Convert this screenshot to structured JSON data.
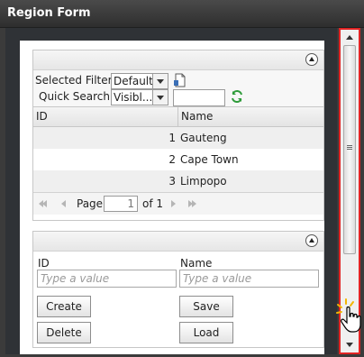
{
  "window": {
    "title": "Region Form"
  },
  "filter": {
    "selected_filter_label": "Selected Filter:",
    "selected_filter_value": "Default",
    "quick_search_label": "Quick Search:",
    "quick_search_field": "Visibl...",
    "quick_search_value": ""
  },
  "grid": {
    "columns": [
      "ID",
      "Name"
    ],
    "rows": [
      {
        "id": "1",
        "name": "Gauteng"
      },
      {
        "id": "2",
        "name": "Cape Town"
      },
      {
        "id": "3",
        "name": "Limpopo"
      }
    ],
    "pager": {
      "page_label": "Page",
      "page_value": "1",
      "of_label": "of 1"
    }
  },
  "form": {
    "id_label": "ID",
    "id_placeholder": "Type a value",
    "name_label": "Name",
    "name_placeholder": "Type a value",
    "buttons": {
      "create": "Create",
      "save": "Save",
      "delete": "Delete",
      "load": "Load"
    }
  },
  "colors": {
    "scrollbar_highlight": "#e02424",
    "refresh_icon": "#2e9b3a"
  }
}
